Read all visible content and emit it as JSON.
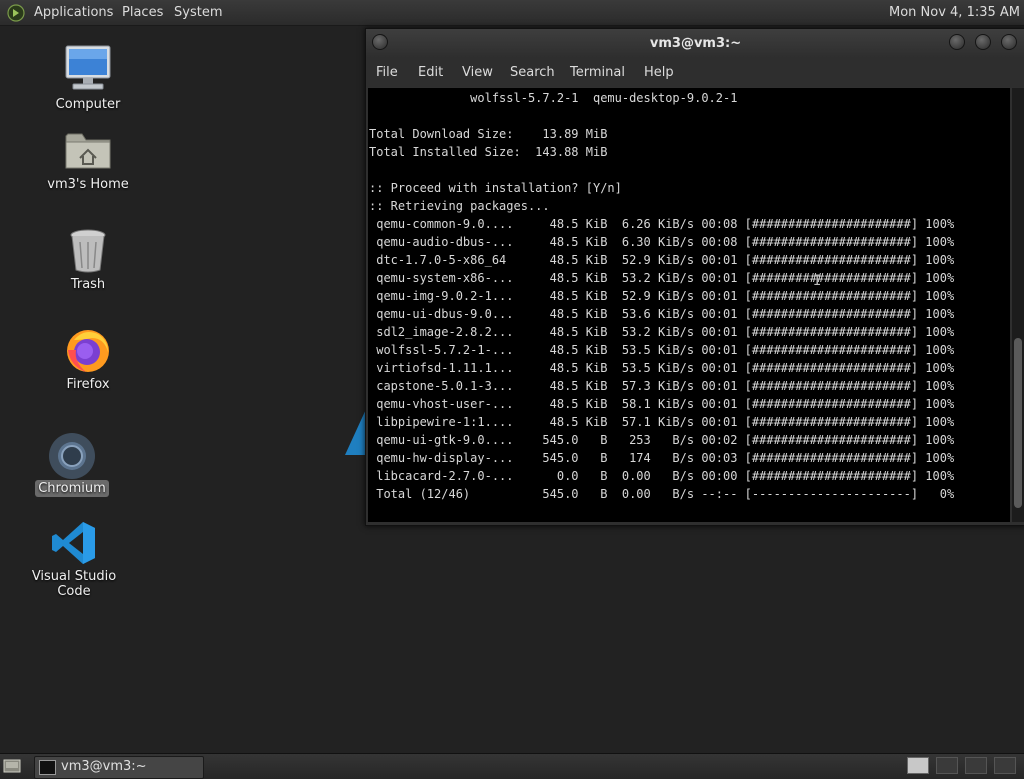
{
  "top_panel": {
    "applications": "Applications",
    "places": "Places",
    "system": "System",
    "clock": "Mon Nov 4,  1:35 AM",
    "apps_icon": "gnome-foot-icon"
  },
  "desktop": {
    "icons": [
      {
        "label": "Computer",
        "icon": "computer-icon"
      },
      {
        "label": "vm3's Home",
        "icon": "home-folder-icon"
      },
      {
        "label": "Trash",
        "icon": "trash-icon"
      },
      {
        "label": "Firefox",
        "icon": "firefox-icon"
      },
      {
        "label": "Chromium",
        "icon": "chromium-icon"
      },
      {
        "label": "Visual Studio Code",
        "icon": "vscode-icon"
      }
    ]
  },
  "terminal": {
    "title": "vm3@vm3:~",
    "menu": [
      "File",
      "Edit",
      "View",
      "Search",
      "Terminal",
      "Help"
    ],
    "lines": [
      "              wolfssl-5.7.2-1  qemu-desktop-9.0.2-1",
      "",
      "Total Download Size:    13.89 MiB",
      "Total Installed Size:  143.88 MiB",
      "",
      ":: Proceed with installation? [Y/n]",
      ":: Retrieving packages...",
      " qemu-common-9.0....     48.5 KiB  6.26 KiB/s 00:08 [######################] 100%",
      " qemu-audio-dbus-...     48.5 KiB  6.30 KiB/s 00:08 [######################] 100%",
      " dtc-1.7.0-5-x86_64      48.5 KiB  52.9 KiB/s 00:01 [######################] 100%",
      " qemu-system-x86-...     48.5 KiB  53.2 KiB/s 00:01 [######################] 100%",
      " qemu-img-9.0.2-1...     48.5 KiB  52.9 KiB/s 00:01 [######################] 100%",
      " qemu-ui-dbus-9.0...     48.5 KiB  53.6 KiB/s 00:01 [######################] 100%",
      " sdl2_image-2.8.2...     48.5 KiB  53.2 KiB/s 00:01 [######################] 100%",
      " wolfssl-5.7.2-1-...     48.5 KiB  53.5 KiB/s 00:01 [######################] 100%",
      " virtiofsd-1.11.1...     48.5 KiB  53.5 KiB/s 00:01 [######################] 100%",
      " capstone-5.0.1-3...     48.5 KiB  57.3 KiB/s 00:01 [######################] 100%",
      " qemu-vhost-user-...     48.5 KiB  58.1 KiB/s 00:01 [######################] 100%",
      " libpipewire-1:1....     48.5 KiB  57.1 KiB/s 00:01 [######################] 100%",
      " qemu-ui-gtk-9.0....    545.0   B   253   B/s 00:02 [######################] 100%",
      " qemu-hw-display-...    545.0   B   174   B/s 00:03 [######################] 100%",
      " libcacard-2.7.0-...      0.0   B  0.00   B/s 00:00 [######################] 100%",
      " Total (12/46)          545.0   B  0.00   B/s --:-- [----------------------]   0%"
    ]
  },
  "taskbar": {
    "task_label": "vm3@vm3:~",
    "show_desktop_icon": "show-desktop-icon",
    "terminal_icon": "terminal-icon"
  }
}
